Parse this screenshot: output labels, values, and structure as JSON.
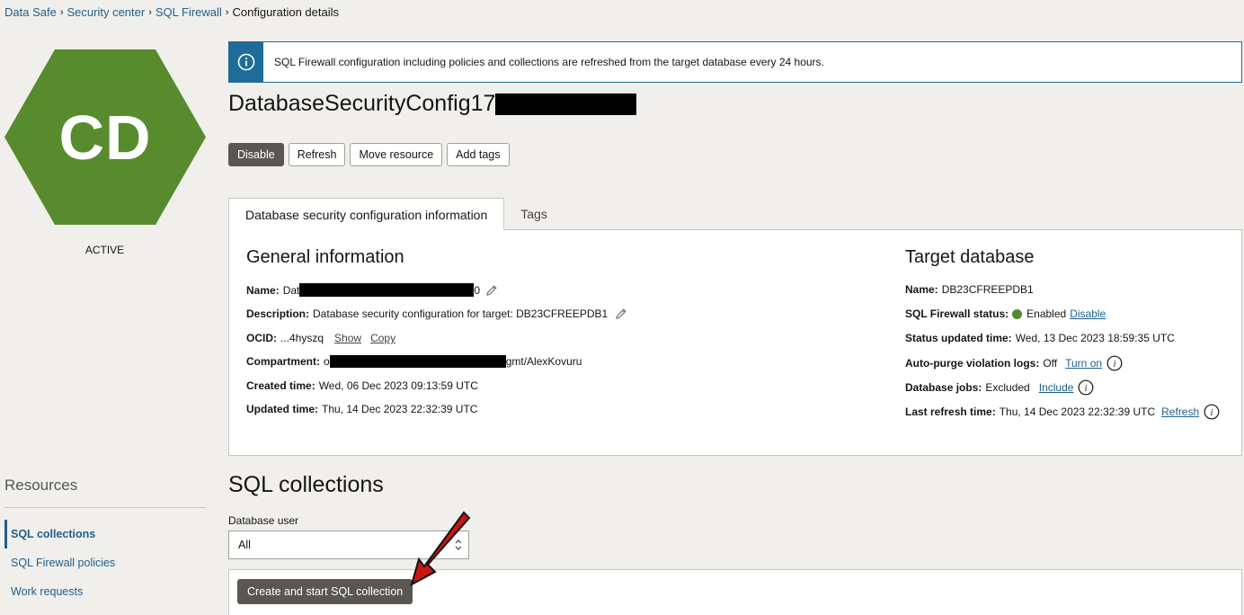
{
  "breadcrumb": {
    "items": [
      "Data Safe",
      "Security center",
      "SQL Firewall"
    ],
    "separator": "›",
    "current": "Configuration details"
  },
  "resource_icon": {
    "initials": "CD",
    "status": "ACTIVE",
    "color": "#578b2e"
  },
  "resources": {
    "title": "Resources",
    "items": [
      "SQL collections",
      "SQL Firewall policies",
      "Work requests"
    ]
  },
  "banner": {
    "text": "SQL Firewall configuration including policies and collections are refreshed from the target database every 24 hours."
  },
  "page_title": "DatabaseSecurityConfig17",
  "actions": {
    "disable": "Disable",
    "refresh": "Refresh",
    "move_resource": "Move resource",
    "add_tags": "Add tags"
  },
  "tabs": {
    "info": "Database security configuration information",
    "tags": "Tags"
  },
  "general": {
    "title": "General information",
    "name_label": "Name:",
    "name_prefix": "Dat",
    "name_suffix": "0",
    "description_label": "Description:",
    "description_value": "Database security configuration for target: DB23CFREEPDB1",
    "ocid_label": "OCID:",
    "ocid_value": "...4hyszq",
    "ocid_show": "Show",
    "ocid_copy": "Copy",
    "compartment_label": "Compartment:",
    "compartment_prefix": "o",
    "compartment_suffix": "gmt/AlexKovuru",
    "created_label": "Created time:",
    "created_value": "Wed, 06 Dec 2023 09:13:59 UTC",
    "updated_label": "Updated time:",
    "updated_value": "Thu, 14 Dec 2023 22:32:39 UTC"
  },
  "target": {
    "title": "Target database",
    "name_label": "Name:",
    "name_value": "DB23CFREEPDB1",
    "fw_status_label": "SQL Firewall status:",
    "fw_status_value": "Enabled",
    "fw_status_action": "Disable",
    "status_updated_label": "Status updated time:",
    "status_updated_value": "Wed, 13 Dec 2023 18:59:35 UTC",
    "autopurge_label": "Auto-purge violation logs:",
    "autopurge_value": "Off",
    "autopurge_action": "Turn on",
    "jobs_label": "Database jobs:",
    "jobs_value": "Excluded",
    "jobs_action": "Include",
    "last_refresh_label": "Last refresh time:",
    "last_refresh_value": "Thu, 14 Dec 2023 22:32:39 UTC",
    "last_refresh_action": "Refresh"
  },
  "sql_collections": {
    "title": "SQL collections",
    "db_user_label": "Database user",
    "db_user_value": "All",
    "create_button": "Create and start SQL collection"
  },
  "colors": {
    "link": "#1f5f8b",
    "primary_button": "#5b5652",
    "banner_accent": "#1f6b9a",
    "status_enabled": "#4f8a2f",
    "annotation_arrow": "#c81414"
  }
}
